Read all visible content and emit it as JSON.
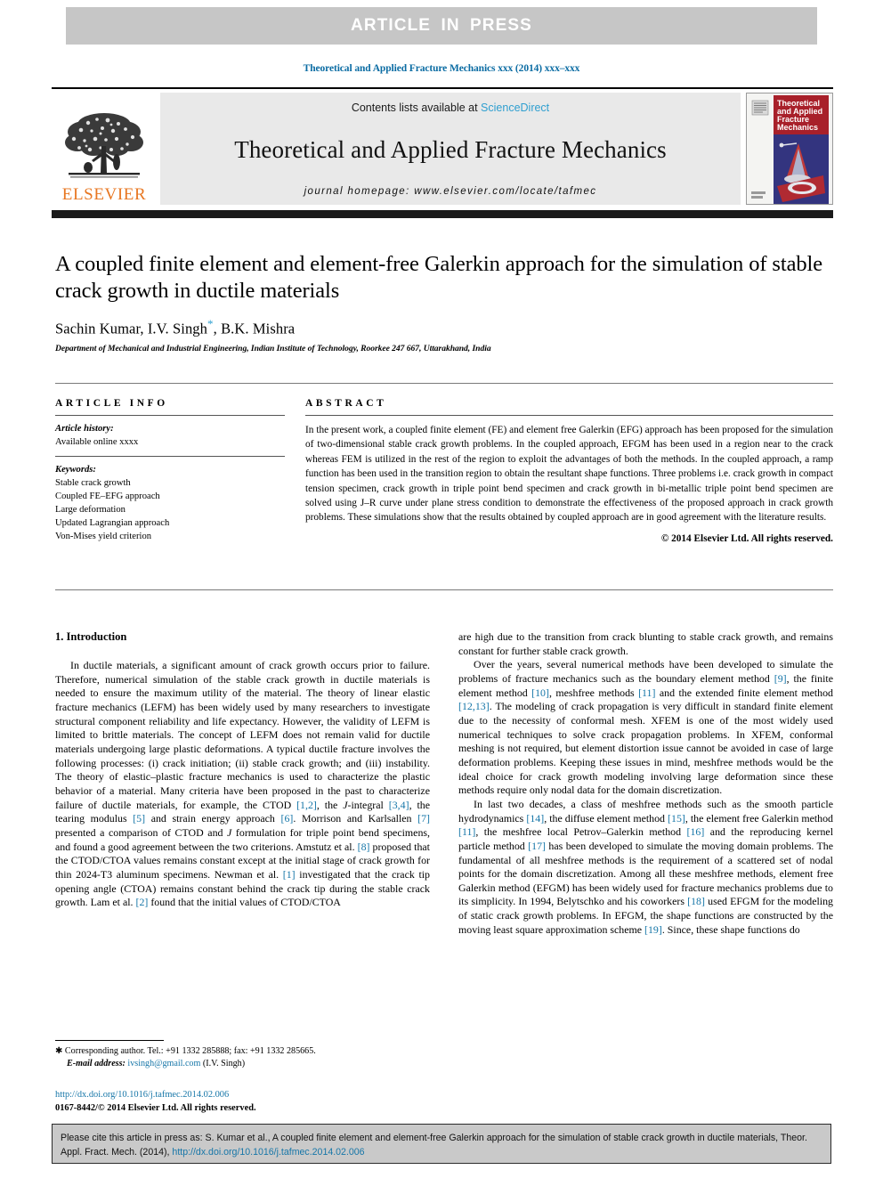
{
  "banner": {
    "label": "ARTICLE  IN  PRESS"
  },
  "running_head": "Theoretical and Applied Fracture Mechanics xxx (2014) xxx–xxx",
  "masthead": {
    "publisher": "ELSEVIER",
    "contents_prefix": "Contents lists available at ",
    "sciencedirect": "ScienceDirect",
    "journal_title": "Theoretical and Applied Fracture Mechanics",
    "homepage": "journal homepage: www.elsevier.com/locate/tafmec",
    "cover_title_lines": [
      "Theoretical",
      "and Applied",
      "Fracture",
      "Mechanics"
    ]
  },
  "article": {
    "title": "A coupled finite element and element-free Galerkin approach for the simulation of stable crack growth in ductile materials",
    "authors_pre": "Sachin Kumar, I.V. Singh",
    "authors_star": "*",
    "authors_post": ", B.K. Mishra",
    "affiliation": "Department of Mechanical and Industrial Engineering, Indian Institute of Technology, Roorkee 247 667, Uttarakhand, India"
  },
  "info": {
    "heading": "ARTICLE INFO",
    "history_label": "Article history:",
    "history_value": "Available online xxxx",
    "keywords_label": "Keywords:",
    "keywords": [
      "Stable crack growth",
      "Coupled FE–EFG approach",
      "Large deformation",
      "Updated Lagrangian approach",
      "Von-Mises yield criterion"
    ]
  },
  "abstract": {
    "heading": "ABSTRACT",
    "text": "In the present work, a coupled finite element (FE) and element free Galerkin (EFG) approach has been proposed for the simulation of two-dimensional stable crack growth problems. In the coupled approach, EFGM has been used in a region near to the crack whereas FEM is utilized in the rest of the region to exploit the advantages of both the methods. In the coupled approach, a ramp function has been used in the transition region to obtain the resultant shape functions. Three problems i.e. crack growth in compact tension specimen, crack growth in triple point bend specimen and crack growth in bi-metallic triple point bend specimen are solved using J–R curve under plane stress condition to demonstrate the effectiveness of the proposed approach in crack growth problems. These simulations show that the results obtained by coupled approach are in good agreement with the literature results.",
    "copyright": "© 2014 Elsevier Ltd. All rights reserved."
  },
  "body": {
    "section_title": "1. Introduction",
    "left_paragraphs": [
      "In ductile materials, a significant amount of crack growth occurs prior to failure. Therefore, numerical simulation of the stable crack growth in ductile materials is needed to ensure the maximum utility of the material. The theory of linear elastic fracture mechanics (LEFM) has been widely used by many researchers to investigate structural component reliability and life expectancy. However, the validity of LEFM is limited to brittle materials. The concept of LEFM does not remain valid for ductile materials undergoing large plastic deformations. A typical ductile fracture involves the following processes: (i) crack initiation; (ii) stable crack growth; and (iii) instability. The theory of elastic–plastic fracture mechanics is used to characterize the plastic behavior of a material. Many criteria have been proposed in the past to characterize failure of ductile materials, for example, the CTOD [1,2], the J-integral [3,4], the tearing modulus [5] and strain energy approach [6]. Morrison and Karlsallen [7] presented a comparison of CTOD and J formulation for triple point bend specimens, and found a good agreement between the two criterions. Amstutz et al. [8] proposed that the CTOD/CTOA values remains constant except at the initial stage of crack growth for thin 2024-T3 aluminum specimens. Newman et al. [1] investigated that the crack tip opening angle (CTOA) remains constant behind the crack tip during the stable crack growth. Lam et al. [2] found that the initial values of CTOD/CTOA"
    ],
    "right_paragraphs": [
      "are high due to the transition from crack blunting to stable crack growth, and remains constant for further stable crack growth.",
      "Over the years, several numerical methods have been developed to simulate the problems of fracture mechanics such as the boundary element method [9], the finite element method [10], meshfree methods [11] and the extended finite element method [12,13]. The modeling of crack propagation is very difficult in standard finite element due to the necessity of conformal mesh. XFEM is one of the most widely used numerical techniques to solve crack propagation problems. In XFEM, conformal meshing is not required, but element distortion issue cannot be avoided in case of large deformation problems. Keeping these issues in mind, meshfree methods would be the ideal choice for crack growth modeling involving large deformation since these methods require only nodal data for the domain discretization.",
      "In last two decades, a class of meshfree methods such as the smooth particle hydrodynamics [14], the diffuse element method [15], the element free Galerkin method [11], the meshfree local Petrov–Galerkin method [16] and the reproducing kernel particle method [17] has been developed to simulate the moving domain problems. The fundamental of all meshfree methods is the requirement of a scattered set of nodal points for the domain discretization. Among all these meshfree methods, element free Galerkin method (EFGM) has been widely used for fracture mechanics problems due to its simplicity. In 1994, Belytschko and his coworkers [18] used EFGM for the modeling of static crack growth problems. In EFGM, the shape functions are constructed by the moving least square approximation scheme [19]. Since, these shape functions do"
    ]
  },
  "footnote": {
    "corresponding": "Corresponding author. Tel.: +91 1332 285888; fax: +91 1332 285665.",
    "email_label": "E-mail address:",
    "email": "ivsingh@gmail.com",
    "email_owner": "(I.V. Singh)",
    "doi": "http://dx.doi.org/10.1016/j.tafmec.2014.02.006",
    "issn_line": "0167-8442/© 2014 Elsevier Ltd. All rights reserved."
  },
  "citation": {
    "text_before_link": "Please cite this article in press as: S. Kumar et al., A coupled finite element and element-free Galerkin approach for the simulation of stable crack growth in ductile materials, Theor. Appl. Fract. Mech. (2014), ",
    "link": "http://dx.doi.org/10.1016/j.tafmec.2014.02.006"
  },
  "colors": {
    "link_blue": "#1676a8",
    "sciencedirect_blue": "#2f9fd0",
    "elsevier_orange": "#e87722",
    "banner_gray": "#c6c6c6",
    "cite_box_gray": "#c9c9c9"
  }
}
